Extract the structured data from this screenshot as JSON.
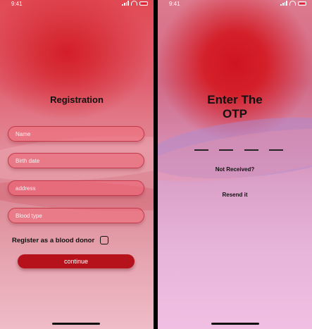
{
  "status_bar": {
    "time": "9:41"
  },
  "registration": {
    "title": "Registration",
    "fields": [
      {
        "placeholder": "Name"
      },
      {
        "placeholder": "Birth date"
      },
      {
        "placeholder": "address"
      },
      {
        "placeholder": "Blood type"
      }
    ],
    "donor_label": "Register as a blood donor",
    "continue_label": "continue"
  },
  "otp": {
    "title_line1": "Enter The",
    "title_line2": "OTP",
    "slot_count": 4,
    "not_received": "Not Received?",
    "resend": "Resend it"
  },
  "colors": {
    "accent": "#b5121c",
    "primary_red": "#d41e2a"
  }
}
